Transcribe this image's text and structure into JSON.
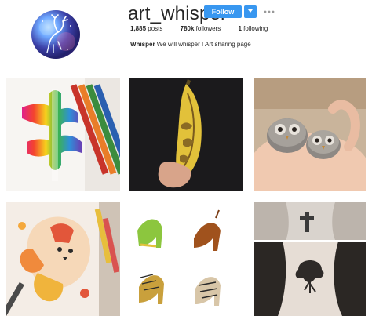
{
  "profile": {
    "username": "art_whisper",
    "follow_label": "Follow",
    "posts_count": "1,885",
    "posts_label": "posts",
    "followers_count": "780k",
    "followers_label": "followers",
    "following_count": "1",
    "following_label": "following",
    "bio_name": "Whisper",
    "bio_text": "We will whisper ! Art sharing page"
  },
  "posts": [
    {
      "subject": "rainbow paper cut drawing with colored pencils"
    },
    {
      "subject": "carved banana art"
    },
    {
      "subject": "owl painted stones in hand"
    },
    {
      "subject": "fox and flowers illustration with markers"
    },
    {
      "subject": "high heel shoe drawings"
    },
    {
      "subject": "neck tattoos cross and tree"
    }
  ],
  "colors": {
    "accent": "#3897f0",
    "text": "#262626"
  },
  "icons": {
    "dropdown": "chevron-down-icon",
    "more": "more-options-icon"
  }
}
